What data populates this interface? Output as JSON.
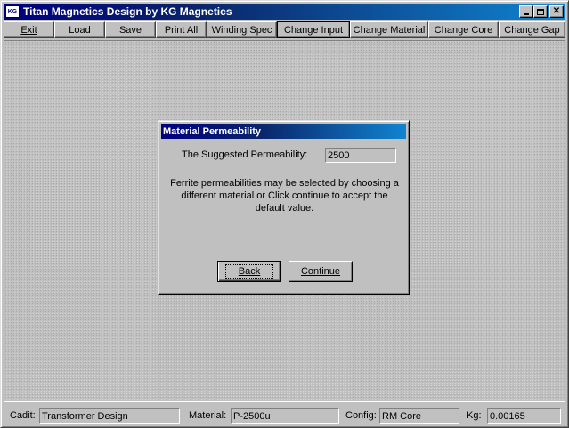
{
  "window": {
    "title": "Titan Magnetics Design by KG Magnetics",
    "icon_text": "KG",
    "minimize_icon": "minimize-icon",
    "maximize_icon": "maximize-icon",
    "close_icon": "close-icon",
    "close_glyph": "✕"
  },
  "toolbar": {
    "exit": "Exit",
    "load": "Load",
    "save": "Save",
    "print_all": "Print All",
    "winding_spec": "Winding Spec",
    "change_input": "Change Input",
    "change_material": "Change Material",
    "change_core": "Change Core",
    "change_gap": "Change Gap"
  },
  "dialog": {
    "title": "Material Permeability",
    "perm_label": "The Suggested Permeability:",
    "perm_value": "2500",
    "message": "Ferrite permeabilities may be selected by choosing a different material or Click continue to accept the default value.",
    "back_button": "Back",
    "continue_button": "Continue"
  },
  "status": {
    "cadit_label": "Cadit:",
    "cadit_value": "Transformer Design",
    "material_label": "Material:",
    "material_value": "P-2500u",
    "config_label": "Config:",
    "config_value": "RM Core",
    "kg_label": "Kg:",
    "kg_value": "0.00165"
  },
  "colors": {
    "face": "#c0c0c0",
    "title_start": "#000080",
    "title_end": "#1084d0"
  }
}
